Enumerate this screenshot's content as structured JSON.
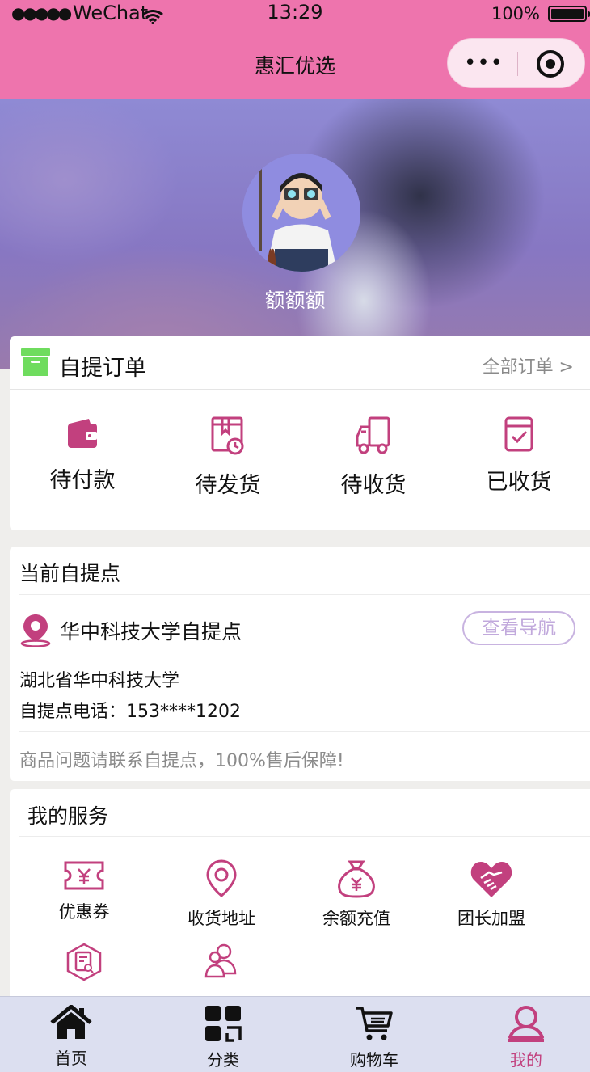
{
  "status_bar": {
    "signal": "●●●●●",
    "carrier": "WeChat",
    "time": "13:29",
    "battery": "100%"
  },
  "nav": {
    "title": "惠汇优选",
    "more_label": "•••"
  },
  "profile": {
    "username": "额额额"
  },
  "orders": {
    "title": "自提订单",
    "all_link": "全部订单 >",
    "items": [
      {
        "label": "待付款",
        "icon": "wallet-icon"
      },
      {
        "label": "待发货",
        "icon": "package-clock-icon"
      },
      {
        "label": "待收货",
        "icon": "truck-icon"
      },
      {
        "label": "已收货",
        "icon": "receipt-check-icon"
      }
    ]
  },
  "pickup": {
    "title": "当前自提点",
    "name": "华中科技大学自提点",
    "nav_button": "查看导航",
    "address": "湖北省华中科技大学",
    "phone": "自提点电话：153****1202",
    "notice": "商品问题请联系自提点，100%售后保障!"
  },
  "services": {
    "title": "我的服务",
    "items": [
      {
        "label": "优惠券",
        "icon": "coupon-icon"
      },
      {
        "label": "收货地址",
        "icon": "location-pin-icon"
      },
      {
        "label": "余额充值",
        "icon": "money-bag-icon"
      },
      {
        "label": "团长加盟",
        "icon": "handshake-heart-icon"
      },
      {
        "label": "",
        "icon": "report-search-icon"
      },
      {
        "label": "",
        "icon": "users-icon"
      }
    ]
  },
  "tabbar": {
    "items": [
      {
        "label": "首页",
        "icon": "home-icon"
      },
      {
        "label": "分类",
        "icon": "category-grid-icon"
      },
      {
        "label": "购物车",
        "icon": "cart-icon"
      },
      {
        "label": "我的",
        "icon": "user-icon"
      }
    ],
    "active_index": 3
  },
  "colors": {
    "brand_pink": "#ee74ad",
    "icon_magenta": "#c2407e",
    "order_box_green": "#6fdc5e",
    "nav_button_purple": "#c1a9dc",
    "tabbar_bg": "#dcdff0"
  }
}
